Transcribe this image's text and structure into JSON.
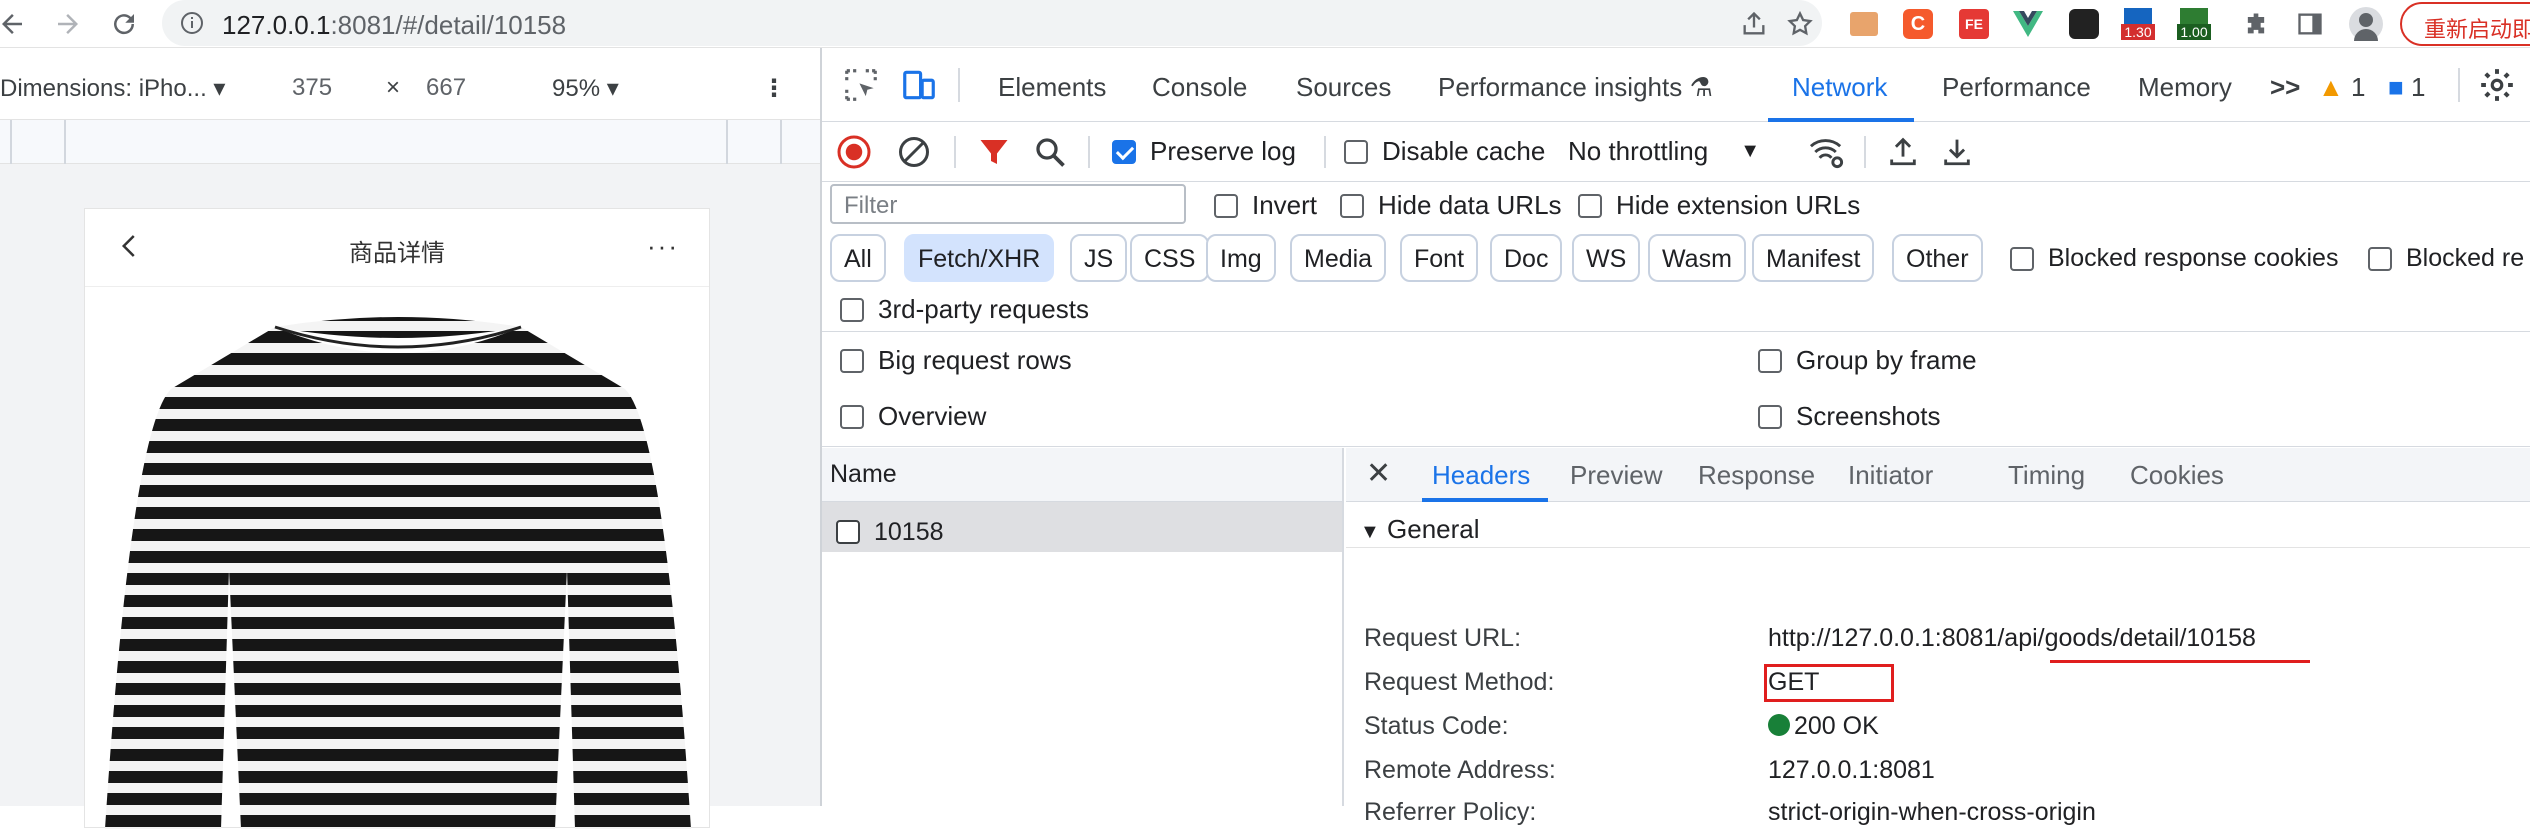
{
  "browser": {
    "url_host": "127.0.0.1",
    "url_rest": ":8081/#/detail/10158",
    "restart_label": "重新启动即",
    "ext_badges": [
      "1.30",
      "1.00"
    ],
    "colors": {
      "accent": "#1a73e8",
      "danger": "#d93025"
    }
  },
  "device": {
    "dimensions_label": "Dimensions: iPho...",
    "width": "375",
    "times": "×",
    "height": "667",
    "zoom": "95%"
  },
  "phone": {
    "title": "商品详情",
    "more": "···"
  },
  "devtools": {
    "tabs": [
      "Elements",
      "Console",
      "Sources",
      "Performance insights",
      "Network",
      "Performance",
      "Memory"
    ],
    "active_tab": "Network",
    "more_tabs": ">>",
    "warnings": "1",
    "messages": "1",
    "toolbar": {
      "preserve_log": "Preserve log",
      "disable_cache": "Disable cache",
      "throttling": "No throttling"
    },
    "filter": {
      "placeholder": "Filter",
      "invert": "Invert",
      "hide_data_urls": "Hide data URLs",
      "hide_extension_urls": "Hide extension URLs"
    },
    "types": [
      "All",
      "Fetch/XHR",
      "JS",
      "CSS",
      "Img",
      "Media",
      "Font",
      "Doc",
      "WS",
      "Wasm",
      "Manifest",
      "Other"
    ],
    "active_type": "Fetch/XHR",
    "blocked_response_cookies": "Blocked response cookies",
    "blocked_requests": "Blocked re",
    "third_party": "3rd-party requests",
    "options": {
      "big_rows": "Big request rows",
      "group_by_frame": "Group by frame",
      "overview": "Overview",
      "screenshots": "Screenshots"
    },
    "list": {
      "name_header": "Name",
      "requests": [
        "10158"
      ]
    },
    "details": {
      "close": "✕",
      "tabs": [
        "Headers",
        "Preview",
        "Response",
        "Initiator",
        "Timing",
        "Cookies"
      ],
      "active_tab": "Headers",
      "section": "General",
      "rows": [
        {
          "key": "Request URL:",
          "value": "http://127.0.0.1:8081/api/goods/detail/10158"
        },
        {
          "key": "Request Method:",
          "value": "GET"
        },
        {
          "key": "Status Code:",
          "value": "200 OK"
        },
        {
          "key": "Remote Address:",
          "value": "127.0.0.1:8081"
        },
        {
          "key": "Referrer Policy:",
          "value": "strict-origin-when-cross-origin"
        }
      ]
    }
  }
}
